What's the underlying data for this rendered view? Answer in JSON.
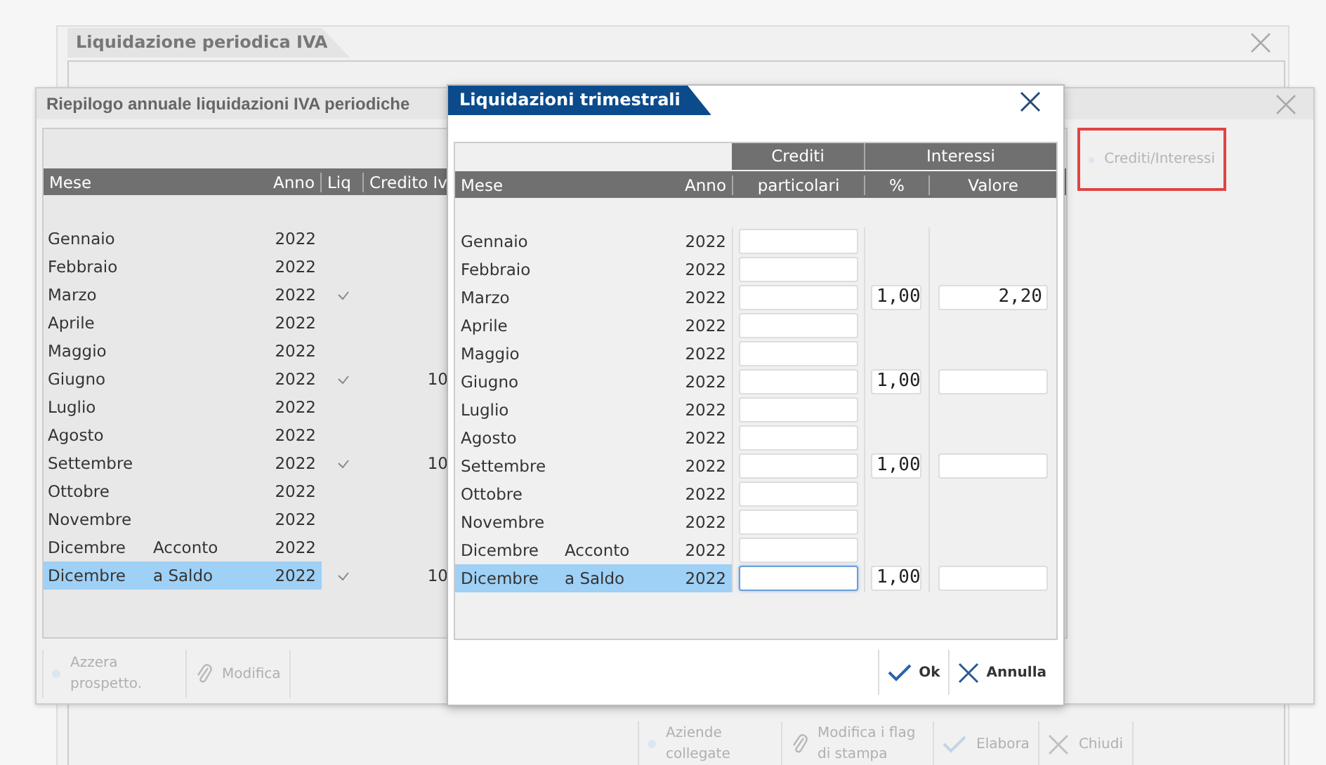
{
  "main_window": {
    "title": "Liquidazione periodica IVA",
    "toolbar": [
      {
        "label": "Aziende collegate",
        "kind": "dot",
        "disabled": true
      },
      {
        "label": "Modifica i flag di stampa",
        "kind": "edit",
        "disabled": true
      },
      {
        "label": "Elabora",
        "kind": "confirm",
        "disabled": true
      },
      {
        "label": "Chiudi",
        "kind": "close",
        "disabled": true
      }
    ]
  },
  "summary_window": {
    "title": "Riepilogo annuale liquidazioni IVA periodiche",
    "columns": [
      "Mese",
      "Anno",
      "Liq",
      "Credito Iv"
    ],
    "rows": [
      {
        "mese": "Gennaio",
        "anno": "2022",
        "liq": false,
        "selected": false
      },
      {
        "mese": "Febbraio",
        "anno": "2022",
        "liq": false,
        "selected": false
      },
      {
        "mese": "Marzo",
        "anno": "2022",
        "liq": true,
        "selected": false
      },
      {
        "mese": "Aprile",
        "anno": "2022",
        "liq": false,
        "selected": false
      },
      {
        "mese": "Maggio",
        "anno": "2022",
        "liq": false,
        "selected": false
      },
      {
        "mese": "Giugno",
        "anno": "2022",
        "liq": true,
        "credito": "10",
        "selected": false
      },
      {
        "mese": "Luglio",
        "anno": "2022",
        "liq": false,
        "selected": false
      },
      {
        "mese": "Agosto",
        "anno": "2022",
        "liq": false,
        "selected": false
      },
      {
        "mese": "Settembre",
        "anno": "2022",
        "liq": true,
        "credito": "10",
        "selected": false
      },
      {
        "mese": "Ottobre",
        "anno": "2022",
        "liq": false,
        "selected": false
      },
      {
        "mese": "Novembre",
        "anno": "2022",
        "liq": false,
        "selected": false
      },
      {
        "mese": "Dicembre",
        "periodo": "Acconto",
        "anno": "2022",
        "liq": false,
        "selected": false
      },
      {
        "mese": "Dicembre",
        "periodo": "a Saldo",
        "anno": "2022",
        "liq": true,
        "credito": "10",
        "selected": true
      }
    ],
    "toolbar": [
      {
        "label": "Azzera prospetto.",
        "kind": "dot",
        "disabled": true
      },
      {
        "label": "Modifica",
        "kind": "edit",
        "disabled": true
      }
    ],
    "side_button": {
      "label": "Crediti/Interessi",
      "disabled": true,
      "highlighted": true
    }
  },
  "dialog": {
    "title": "Liquidazioni trimestrali",
    "header_groups": [
      "Crediti",
      "Interessi"
    ],
    "columns": [
      "Mese",
      "Anno",
      "particolari",
      "%",
      "Valore"
    ],
    "rows": [
      {
        "mese": "Gennaio",
        "anno": "2022",
        "selected": false
      },
      {
        "mese": "Febbraio",
        "anno": "2022",
        "selected": false
      },
      {
        "mese": "Marzo",
        "anno": "2022",
        "interessi": {
          "percent": "1,00",
          "valore": "2,20"
        },
        "selected": false
      },
      {
        "mese": "Aprile",
        "anno": "2022",
        "selected": false
      },
      {
        "mese": "Maggio",
        "anno": "2022",
        "selected": false
      },
      {
        "mese": "Giugno",
        "anno": "2022",
        "interessi": {
          "percent": "1,00"
        },
        "selected": false
      },
      {
        "mese": "Luglio",
        "anno": "2022",
        "selected": false
      },
      {
        "mese": "Agosto",
        "anno": "2022",
        "selected": false
      },
      {
        "mese": "Settembre",
        "anno": "2022",
        "interessi": {
          "percent": "1,00"
        },
        "selected": false
      },
      {
        "mese": "Ottobre",
        "anno": "2022",
        "selected": false
      },
      {
        "mese": "Novembre",
        "anno": "2022",
        "selected": false
      },
      {
        "mese": "Dicembre",
        "periodo": "Acconto",
        "anno": "2022",
        "selected": false
      },
      {
        "mese": "Dicembre",
        "periodo": "a Saldo",
        "anno": "2022",
        "interessi": {
          "percent": "1,00"
        },
        "selected": true
      }
    ],
    "buttons": [
      {
        "label": "Ok",
        "kind": "confirm",
        "disabled": false
      },
      {
        "label": "Annulla",
        "kind": "close",
        "disabled": false
      }
    ]
  }
}
